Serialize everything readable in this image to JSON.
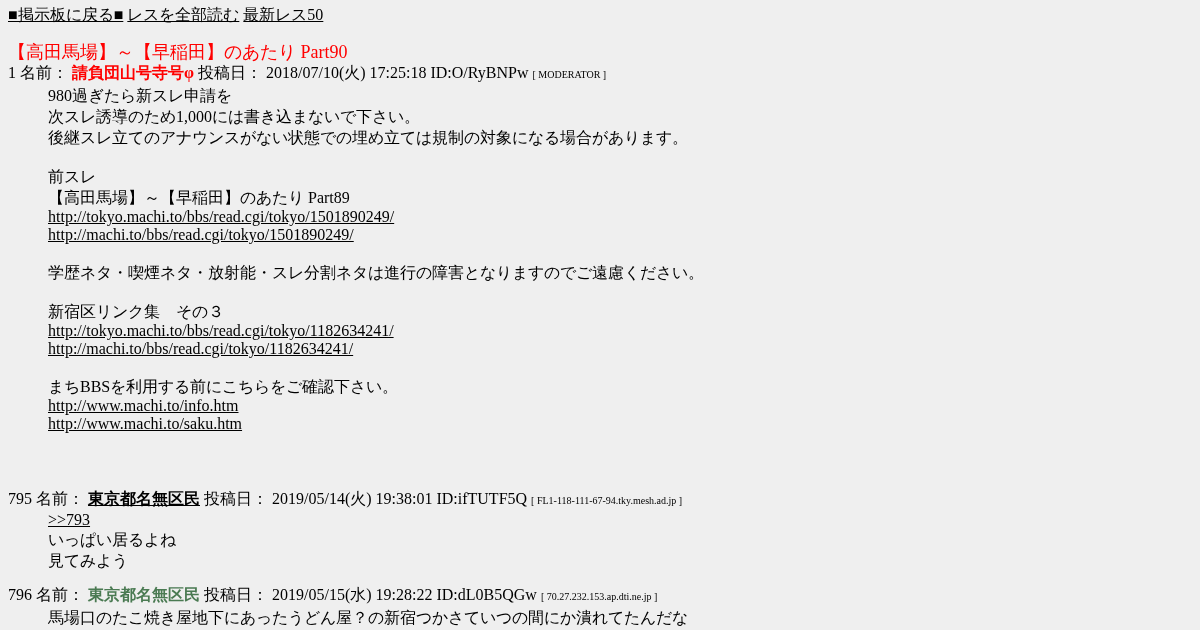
{
  "nav": [
    {
      "text": "■掲示板に戻る■"
    },
    {
      "text": "レスを全部読む"
    },
    {
      "text": "最新レス50"
    }
  ],
  "thread_title": "【高田馬場】～【早稲田】のあたり Part90",
  "posts": [
    {
      "number": "1",
      "name_label": "名前：",
      "name": {
        "text": "請負団山号寺号φ",
        "color": "#ff0000",
        "link": false
      },
      "date_label": "投稿日：",
      "date": "2018/07/10(火) 17:25:18",
      "id": "ID:O/RyBNPw",
      "host": "[ MODERATOR ]",
      "paragraphs": [
        {
          "lines": [
            {
              "kind": "text",
              "text": "980過ぎたら新スレ申請を"
            },
            {
              "kind": "text",
              "text": "次スレ誘導のため1,000には書き込まないで下さい。"
            },
            {
              "kind": "text",
              "text": "後継スレ立てのアナウンスがない状態での埋め立ては規制の対象になる場合があります。"
            }
          ]
        },
        {
          "lines": [
            {
              "kind": "text",
              "text": "前スレ"
            },
            {
              "kind": "text",
              "text": "【高田馬場】～【早稲田】のあたり Part89"
            },
            {
              "kind": "link",
              "text": "http://tokyo.machi.to/bbs/read.cgi/tokyo/1501890249/"
            },
            {
              "kind": "link",
              "text": "http://machi.to/bbs/read.cgi/tokyo/1501890249/"
            }
          ]
        },
        {
          "lines": [
            {
              "kind": "text",
              "text": "学歴ネタ・喫煙ネタ・放射能・スレ分割ネタは進行の障害となりますのでご遠慮ください。"
            }
          ]
        },
        {
          "lines": [
            {
              "kind": "text",
              "text": "新宿区リンク集　その３"
            },
            {
              "kind": "link",
              "text": "http://tokyo.machi.to/bbs/read.cgi/tokyo/1182634241/"
            },
            {
              "kind": "link",
              "text": "http://machi.to/bbs/read.cgi/tokyo/1182634241/"
            }
          ]
        },
        {
          "lines": [
            {
              "kind": "text",
              "text": "まちBBSを利用する前にこちらをご確認下さい。"
            },
            {
              "kind": "link",
              "text": "http://www.machi.to/info.htm"
            },
            {
              "kind": "link",
              "text": "http://www.machi.to/saku.htm"
            }
          ]
        }
      ]
    },
    {
      "number": "795",
      "name_label": "名前：",
      "name": {
        "text": "東京都名無区民",
        "color": "#000000",
        "link": true
      },
      "date_label": "投稿日：",
      "date": "2019/05/14(火) 19:38:01",
      "id": "ID:ifTUTF5Q",
      "host": "[ FL1-118-111-67-94.tky.mesh.ad.jp ]",
      "paragraphs": [
        {
          "lines": [
            {
              "kind": "link",
              "text": ">>793"
            },
            {
              "kind": "text",
              "text": "いっぱい居るよね"
            },
            {
              "kind": "text",
              "text": "見てみよう"
            }
          ]
        }
      ]
    },
    {
      "number": "796",
      "name_label": "名前：",
      "name": {
        "text": "東京都名無区民",
        "color": "#4a7a52",
        "link": false
      },
      "date_label": "投稿日：",
      "date": "2019/05/15(水) 19:28:22",
      "id": "ID:dL0B5QGw",
      "host": "[ 70.27.232.153.ap.dti.ne.jp ]",
      "paragraphs": [
        {
          "lines": [
            {
              "kind": "text",
              "text": "馬場口のたこ焼き屋地下にあったうどん屋？の新宿つかさていつの間にか潰れてたんだな"
            }
          ]
        }
      ]
    }
  ]
}
